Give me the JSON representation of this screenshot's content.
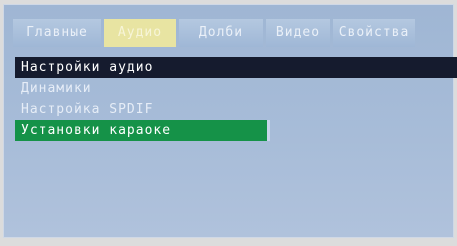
{
  "tabs": [
    {
      "label": "Главные"
    },
    {
      "label": "Аудио"
    },
    {
      "label": "Долби"
    },
    {
      "label": "Видео"
    },
    {
      "label": "Свойства"
    }
  ],
  "menu": {
    "items": [
      {
        "label": "Настройки аудио"
      },
      {
        "label": "Динамики"
      },
      {
        "label": "Настройка SPDIF"
      },
      {
        "label": "Установки караоке"
      }
    ]
  },
  "colors": {
    "panel": "#a7bcd8",
    "active_tab": "#e8e4a2",
    "header_row": "#151b2e",
    "selected_row": "#159248"
  }
}
